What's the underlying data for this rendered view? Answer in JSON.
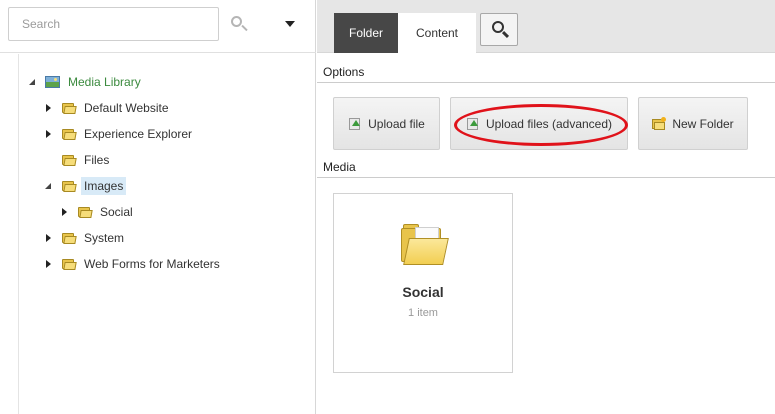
{
  "search": {
    "placeholder": "Search"
  },
  "tree": {
    "root": {
      "label": "Media Library",
      "icon": "media-library-icon"
    },
    "items": [
      {
        "label": "Default Website",
        "icon": "folder-icon",
        "expander": "collapsed"
      },
      {
        "label": "Experience Explorer",
        "icon": "folder-icon",
        "expander": "collapsed"
      },
      {
        "label": "Files",
        "icon": "folder-icon",
        "expander": "none"
      },
      {
        "label": "Images",
        "icon": "folder-icon",
        "expander": "expanded",
        "selected": true
      },
      {
        "label": "Social",
        "icon": "folder-icon",
        "expander": "collapsed"
      },
      {
        "label": "System",
        "icon": "folder-icon",
        "expander": "collapsed"
      },
      {
        "label": "Web Forms for Marketers",
        "icon": "folder-icon",
        "expander": "collapsed"
      }
    ]
  },
  "tabs": [
    {
      "label": "Folder",
      "active": true
    },
    {
      "label": "Content",
      "active": false
    }
  ],
  "sections": {
    "options": "Options",
    "media": "Media"
  },
  "actions": {
    "upload_file": "Upload file",
    "upload_files_advanced": "Upload files (advanced)",
    "new_folder": "New Folder"
  },
  "media_items": [
    {
      "title": "Social",
      "subtitle": "1 item",
      "icon": "folder-icon"
    }
  ],
  "colors": {
    "active_tab": "#474747",
    "tab_bar": "#e6e6e6",
    "selection": "#d8eaf7",
    "root_label": "#3b8a3e",
    "highlight_ring": "#e0121a"
  }
}
